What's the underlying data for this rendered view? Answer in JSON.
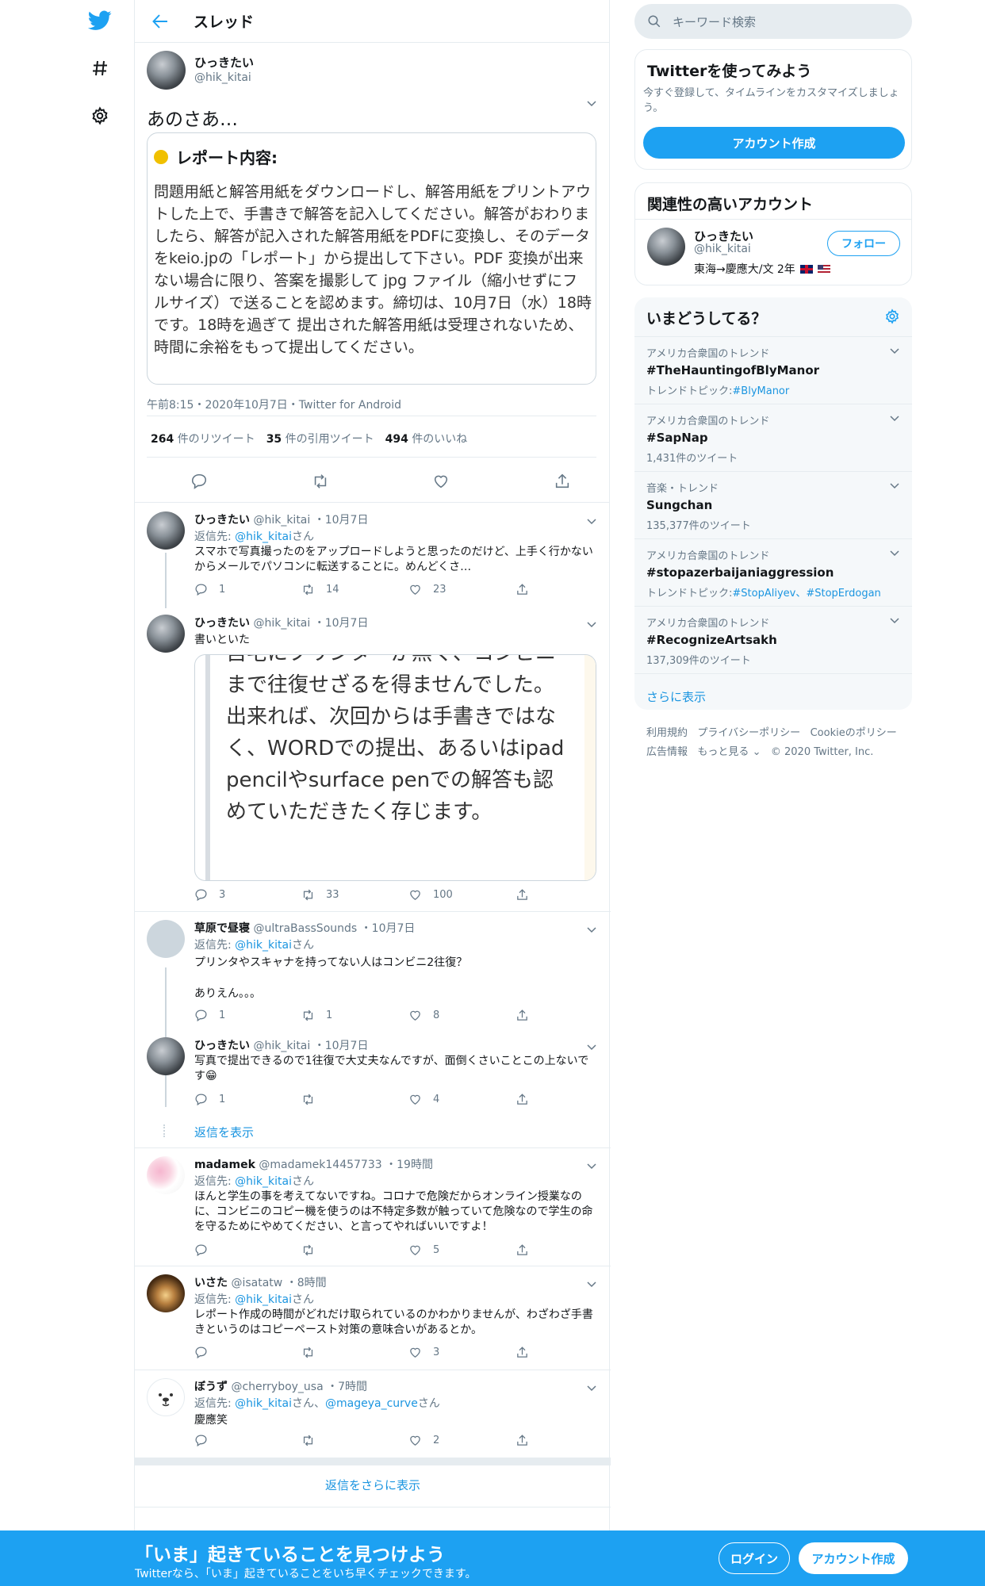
{
  "colors": {
    "brand": "#1da1f2",
    "link": "#1b95e0",
    "text": "#14171a",
    "muted": "#657786",
    "border": "#e6ecf0",
    "panel": "#f5f8fa",
    "like": "#e0245e"
  },
  "leftnav": {
    "icons": [
      "twitter-bird-icon",
      "hashtag-icon",
      "gear-icon"
    ]
  },
  "header": {
    "title": "スレッド"
  },
  "main_tweet": {
    "name": "ひっきたい",
    "handle": "@hik_kitai",
    "text": "あのさあ…",
    "card_title": "レポート内容:",
    "card_body": "問題用紙と解答用紙をダウンロードし、解答用紙をプリントアウトした上で、手書きで解答を記入してください。解答がおわりましたら、解答が記入された解答用紙をPDFに変換し、そのデータをkeio.jpの「レポート」から提出して下さい。PDF 変換が出来ない場合に限り、答案を撮影して jpg ファイル（縮小せずにフルサイズ）で送ることを認めます。締切は、10月7日（水）18時です。18時を過ぎて 提出された解答用紙は受理されないため、時間に余裕をもって提出してください。",
    "timestamp": "午前8:15・2020年10月7日・Twitter for Android",
    "retweets": "264",
    "retweets_label": "件のリツイート",
    "quotes": "35",
    "quotes_label": "件の引用ツイート",
    "likes": "494",
    "likes_label": "件のいいね"
  },
  "replies": [
    {
      "name": "ひっきたい",
      "handle": "@hik_kitai",
      "date": "10月7日",
      "reply_prefix": "返信先:",
      "reply_to": "@hik_kitai",
      "reply_suffix": "さん",
      "text": "スマホで写真撮ったのをアップロードしようと思ったのだけど、上手く行かないからメールでパソコンに転送することに。めんどくさ…",
      "replies": "1",
      "retweets": "14",
      "likes": "23"
    },
    {
      "name": "ひっきたい",
      "handle": "@hik_kitai",
      "date": "10月7日",
      "text": "書いといた",
      "image_text": "自宅にプリンターが無く、コンビニまで往復せざるを得ませんでした。出来れば、次回からは手書きではなく、WORDでの提出、あるいはipad pencilやsurface penでの解答も認めていただきたく存じます。",
      "replies": "3",
      "retweets": "33",
      "likes": "100"
    },
    {
      "name": "草原で昼寝",
      "handle": "@ultraBassSounds",
      "date": "10月7日",
      "reply_prefix": "返信先:",
      "reply_to": "@hik_kitai",
      "reply_suffix": "さん",
      "text": "プリンタやスキャナを持ってない人はコンビニ2往復？",
      "text2": "ありえん。。。",
      "replies": "1",
      "retweets": "1",
      "likes": "8"
    },
    {
      "name": "ひっきたい",
      "handle": "@hik_kitai",
      "date": "10月7日",
      "text": "写真で提出できるので1往復で大丈夫なんですが、面倒くさいことこの上ないです😁",
      "replies": "1",
      "retweets": "",
      "likes": "4"
    },
    {
      "name": "madamek",
      "handle": "@madamek14457733",
      "date": "19時間",
      "reply_prefix": "返信先:",
      "reply_to": "@hik_kitai",
      "reply_suffix": "さん",
      "text": "ほんと学生の事を考えてないですね。コロナで危険だからオンライン授業なのに、コンビニのコピー機を使うのは不特定多数が触っていて危険なので学生の命を守るためにやめてください、と言ってやればいいですよ！",
      "replies": "",
      "retweets": "",
      "likes": "5"
    },
    {
      "name": "いさた",
      "handle": "@isatatw",
      "date": "8時間",
      "reply_prefix": "返信先:",
      "reply_to": "@hik_kitai",
      "reply_suffix": "さん",
      "text": "レポート作成の時間がどれだけ取られているのかわかりませんが、わざわざ手書きというのはコピーペースト対策の意味合いがあるとか。",
      "replies": "",
      "retweets": "",
      "likes": "3"
    },
    {
      "name": "ぼうず",
      "handle": "@cherryboy_usa",
      "date": "7時間",
      "reply_prefix": "返信先:",
      "reply_to": "@hik_kitai",
      "reply_suffix": "さん、",
      "reply_to2": "@mageya_curve",
      "reply_suffix2": "さん",
      "text": "慶應笑",
      "replies": "",
      "retweets": "",
      "likes": "2"
    }
  ],
  "show_replies": "返信を表示",
  "more_replies": "返信をさらに表示",
  "search": {
    "placeholder": "キーワード検索"
  },
  "signup": {
    "title": "Twitterを使ってみよう",
    "desc": "今すぐ登録して、タイムラインをカスタマイズしましょう。",
    "button": "アカウント作成"
  },
  "related": {
    "title": "関連性の高いアカウント",
    "name": "ひっきたい",
    "handle": "@hik_kitai",
    "bio": "東海→慶應大/文 2年",
    "follow": "フォロー"
  },
  "trends": {
    "title": "いまどうしてる？",
    "items": [
      {
        "context": "アメリカ合衆国のトレンド",
        "name": "#TheHauntingofBlyManor",
        "meta_prefix": "トレンドトピック:",
        "meta_link": "#BlyManor"
      },
      {
        "context": "アメリカ合衆国のトレンド",
        "name": "#SapNap",
        "meta": "1,431件のツイート"
      },
      {
        "context": "音楽・トレンド",
        "name": "Sungchan",
        "meta": "135,377件のツイート"
      },
      {
        "context": "アメリカ合衆国のトレンド",
        "name": "#stopazerbaijaniaggression",
        "meta_prefix": "トレンドトピック:",
        "meta_link": "#StopAliyev、#StopErdogan"
      },
      {
        "context": "アメリカ合衆国のトレンド",
        "name": "#RecognizeArtsakh",
        "meta": "137,309件のツイート"
      }
    ],
    "more": "さらに表示"
  },
  "footer": {
    "terms": "利用規約",
    "privacy": "プライバシーポリシー",
    "cookie": "Cookieのポリシー",
    "ads": "広告情報",
    "more": "もっと見る",
    "copyright": "© 2020 Twitter, Inc."
  },
  "bottombar": {
    "headline": "「いま」起きていることを見つけよう",
    "sub": "Twitterなら、「いま」起きていることをいち早くチェックできます。",
    "login": "ログイン",
    "signup": "アカウント作成"
  }
}
